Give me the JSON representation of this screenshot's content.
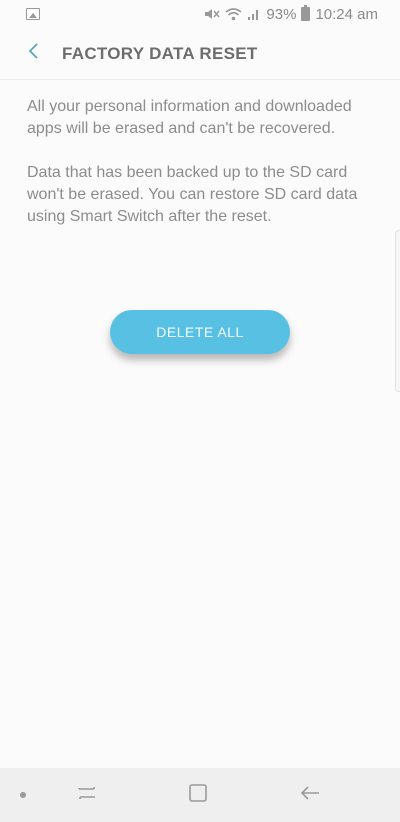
{
  "status_bar": {
    "battery_percent": "93%",
    "time": "10:24 am",
    "left_icons": [
      "gallery-icon"
    ],
    "right_icons": [
      "mute-icon",
      "wifi-icon",
      "signal-icon",
      "battery-icon"
    ]
  },
  "header": {
    "title": "FACTORY DATA RESET",
    "back_icon": "chevron-left-icon",
    "accent_color": "#5aa6b8"
  },
  "content": {
    "paragraphs": [
      "All your personal information and downloaded apps will be erased and can't be recovered.",
      "Data that has been backed up to the SD card won't be erased. You can restore SD card data using Smart Switch after the reset."
    ]
  },
  "action": {
    "delete_label": "DELETE ALL",
    "button_color": "#58c0e2"
  },
  "nav_bar": {
    "buttons": [
      "recents-icon",
      "home-icon",
      "back-icon"
    ]
  }
}
